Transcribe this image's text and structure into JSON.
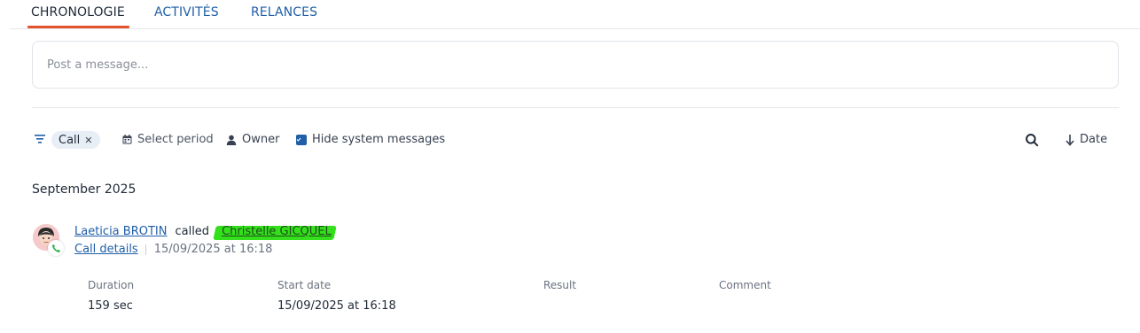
{
  "tabs": [
    {
      "label": "CHRONOLOGIE",
      "active": true
    },
    {
      "label": "ACTIVITÉS",
      "active": false
    },
    {
      "label": "RELANCES",
      "active": false
    }
  ],
  "composer": {
    "placeholder": "Post a message..."
  },
  "filters": {
    "chip_label": "Call",
    "select_period": "Select period",
    "owner": "Owner",
    "hide_system_messages": "Hide system messages",
    "hide_system_checked": true,
    "sort_label": "Date"
  },
  "timeline": {
    "month": "September 2025",
    "entry": {
      "author": "Laeticia BROTIN",
      "verb": "called",
      "contact": "Christelle GICQUEL",
      "details_link": "Call details",
      "timestamp": "15/09/2025 at 16:18",
      "fields": [
        {
          "label": "Duration",
          "value": "159 sec"
        },
        {
          "label": "Start date",
          "value": "15/09/2025 at 16:18"
        },
        {
          "label": "Result",
          "value": ""
        },
        {
          "label": "Comment",
          "value": ""
        }
      ]
    }
  },
  "colors": {
    "accent": "#1f5fa8",
    "tab_indicator": "#e2532d",
    "highlight": "#33e01b",
    "call_icon": "#2eae4e"
  },
  "icons": [
    "filter-icon",
    "close-icon",
    "calendar-icon",
    "person-icon",
    "checkbox-icon",
    "search-icon",
    "arrow-down-icon",
    "phone-icon",
    "avatar"
  ]
}
